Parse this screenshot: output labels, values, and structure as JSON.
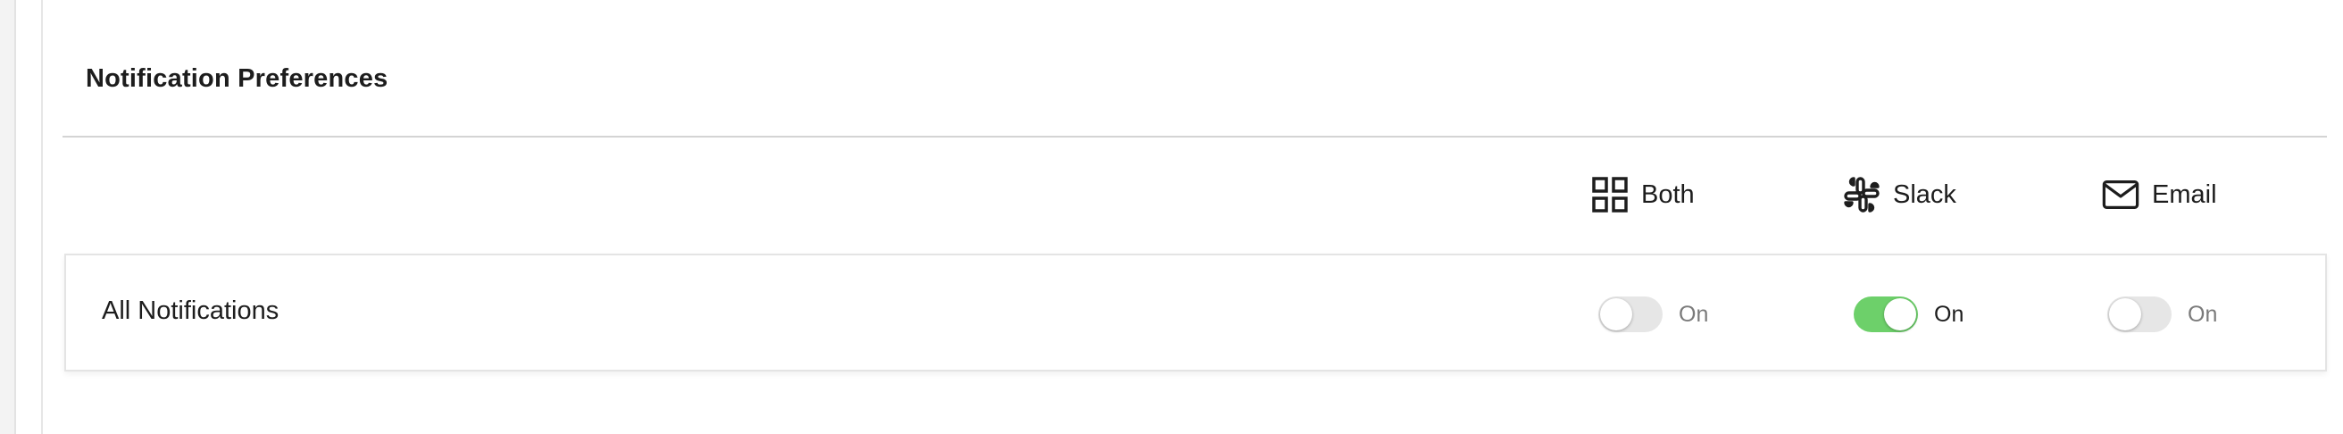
{
  "section": {
    "title": "Notification Preferences"
  },
  "columns": [
    {
      "key": "both",
      "label": "Both",
      "icon": "grid-icon"
    },
    {
      "key": "slack",
      "label": "Slack",
      "icon": "slack-icon"
    },
    {
      "key": "email",
      "label": "Email",
      "icon": "mail-icon"
    }
  ],
  "rows": [
    {
      "label": "All Notifications",
      "toggles": {
        "both": {
          "state": false,
          "text": "On"
        },
        "slack": {
          "state": true,
          "text": "On"
        },
        "email": {
          "state": false,
          "text": "On"
        }
      }
    }
  ],
  "colors": {
    "toggle_on": "#6dd06a",
    "toggle_off": "#e6e6e6"
  }
}
